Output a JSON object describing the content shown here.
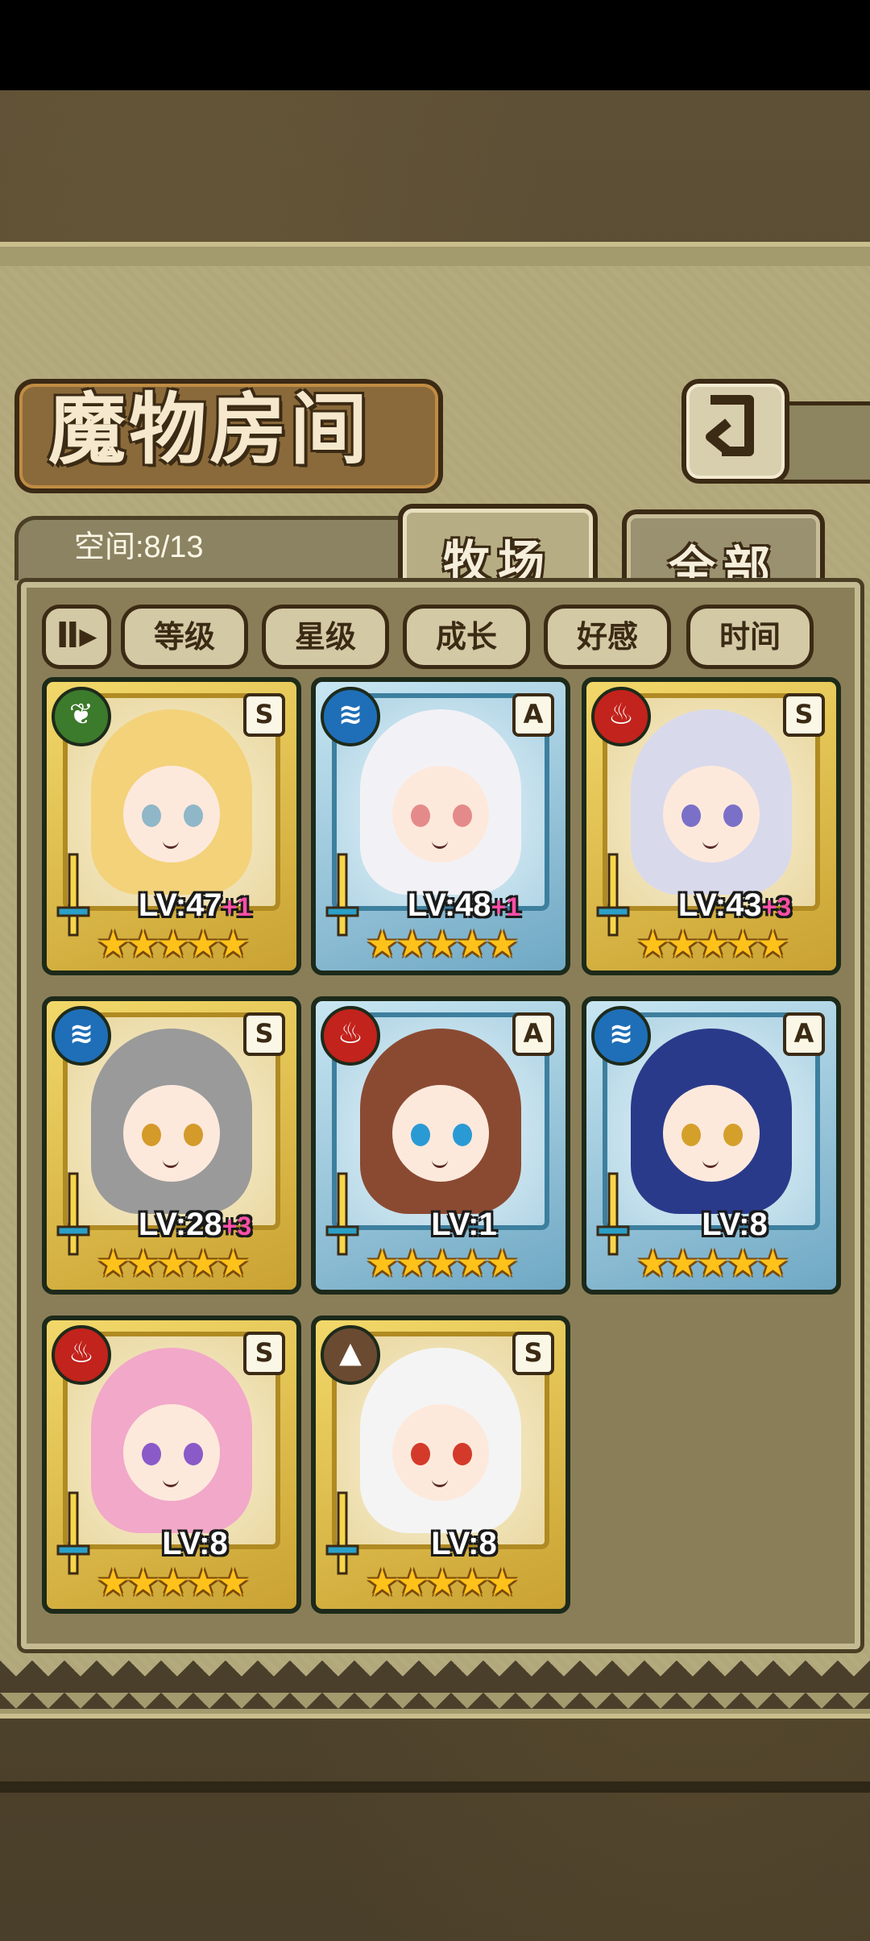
{
  "header": {
    "title": "魔物房间",
    "space_label": "空间:8/13"
  },
  "tabs": [
    {
      "label": "牧场",
      "active": true
    },
    {
      "label": "全部",
      "active": false
    }
  ],
  "sort": {
    "toggle_icon": "Ⅱ▸",
    "buttons": [
      "等级",
      "星级",
      "成长",
      "好感",
      "时间"
    ]
  },
  "monsters": [
    {
      "element": "grass",
      "rank": "S",
      "level": "LV:47",
      "bonus": "+1",
      "stars": "★★★★★",
      "frame": "gold",
      "hair": "#f3d27a",
      "eye": "#8fb7c8"
    },
    {
      "element": "water",
      "rank": "A",
      "level": "LV:48",
      "bonus": "+1",
      "stars": "★★★★★",
      "frame": "blue",
      "hair": "#f2f2f6",
      "eye": "#e58a8a"
    },
    {
      "element": "fire",
      "rank": "S",
      "level": "LV:43",
      "bonus": "+3",
      "stars": "★★★★★",
      "frame": "gold",
      "hair": "#d9d9ec",
      "eye": "#7a70c8"
    },
    {
      "element": "water",
      "rank": "S",
      "level": "LV:28",
      "bonus": "+3",
      "stars": "★★★★★",
      "frame": "gold",
      "hair": "#9a9a9a",
      "eye": "#d49a2a"
    },
    {
      "element": "fire",
      "rank": "A",
      "level": "LV:1",
      "bonus": "",
      "stars": "★★★★★",
      "frame": "blue",
      "hair": "#8a4a32",
      "eye": "#2a9ad4"
    },
    {
      "element": "water",
      "rank": "A",
      "level": "LV:8",
      "bonus": "",
      "stars": "★★★★★",
      "frame": "blue",
      "hair": "#2a3a8a",
      "eye": "#d4a02a"
    },
    {
      "element": "fire",
      "rank": "S",
      "level": "LV:8",
      "bonus": "",
      "stars": "★★★★★",
      "frame": "gold",
      "hair": "#f2a8c8",
      "eye": "#8a5ac8"
    },
    {
      "element": "earth",
      "rank": "S",
      "level": "LV:8",
      "bonus": "",
      "stars": "★★★★★",
      "frame": "gold",
      "hair": "#f4f4f4",
      "eye": "#d43a2a"
    }
  ],
  "element_icons": {
    "grass": "fire-icon",
    "water": "water-icon",
    "fire": "fire-icon",
    "earth": "earth-icon"
  }
}
